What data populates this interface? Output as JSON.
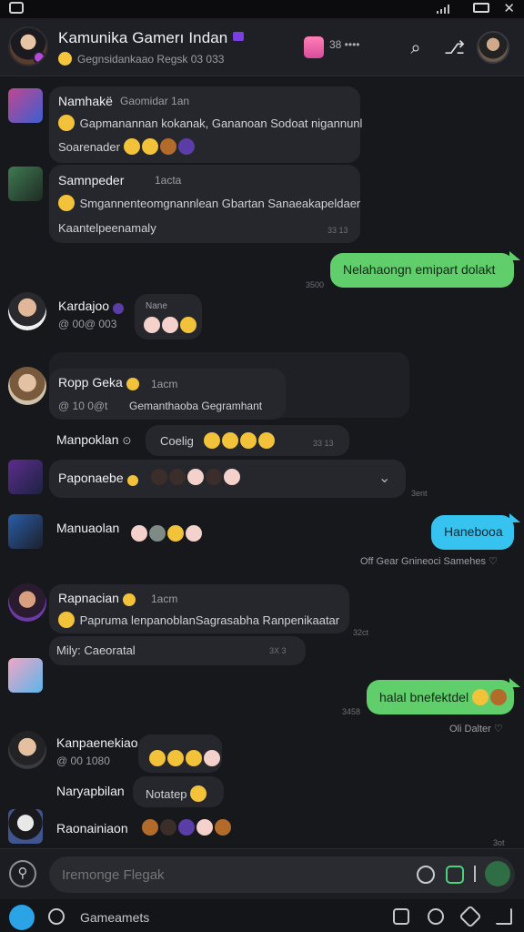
{
  "header": {
    "title": "Kamunika Gamerı Indan",
    "subtitle": "Gegnsidankaao Regsk 03 033",
    "member_count": "38 ••••",
    "icons": [
      "search-icon",
      "filter-icon",
      "profile-avatar"
    ]
  },
  "messages": [
    {
      "sender": "Namhakë",
      "meta": "Gaomidar  1an",
      "line1": "Gapmanannan kokanak, Gananoan Sodoat nigannunl",
      "line2": "Soarenader",
      "timestamp": ""
    },
    {
      "sender": "Samnpeder",
      "meta": "1acta",
      "line1": "Smgannenteomgnannlean Gbartan Sanaeakapeldaer",
      "line2": "Kaantelpeenamaly",
      "timestamp": "33 13"
    },
    {
      "outgoing_text": "Nelahaongn emipart dolakt",
      "timestamp": "3500"
    },
    {
      "sender": "Kardajoo",
      "meta": "@ 00@ 003",
      "reaction_label": "Nane"
    },
    {
      "sender": "Ropp Geka",
      "meta": "1acm",
      "sub_meta": "@ 10 0@t",
      "line1": "Gemanthaoba Gegramhant"
    },
    {
      "sender": "Manpoklan",
      "chip_text": "Coelig",
      "timestamp": "33 13"
    },
    {
      "sender": "Paponaebe",
      "timestamp": "3ent"
    },
    {
      "sender": "Manuaolan",
      "outgoing_text": "Hanebooa",
      "read_status": "Off Gear Gnineoci Samehes"
    },
    {
      "sender": "Rapnacian",
      "meta": "1acm",
      "line1": "Papruma lenpanoblanSagrasabha Ranpenikaatar",
      "timestamp": "32ct"
    },
    {
      "line1": "Mily: Caeoratal",
      "timestamp": "3X 3"
    },
    {
      "outgoing_text": "halal bnefektdel",
      "timestamp": "3458",
      "read_status": "Oli Dalter"
    },
    {
      "sender": "Kanpaenekiao",
      "meta": "@ 00 1080"
    },
    {
      "sender": "Naryapbilan",
      "chip_text": "Notatep"
    },
    {
      "sender": "Raonainiaon",
      "timestamp": "3ot"
    }
  ],
  "composer": {
    "placeholder": "Iremonge Flegak"
  },
  "bottombar": {
    "label": "Gameamets"
  }
}
